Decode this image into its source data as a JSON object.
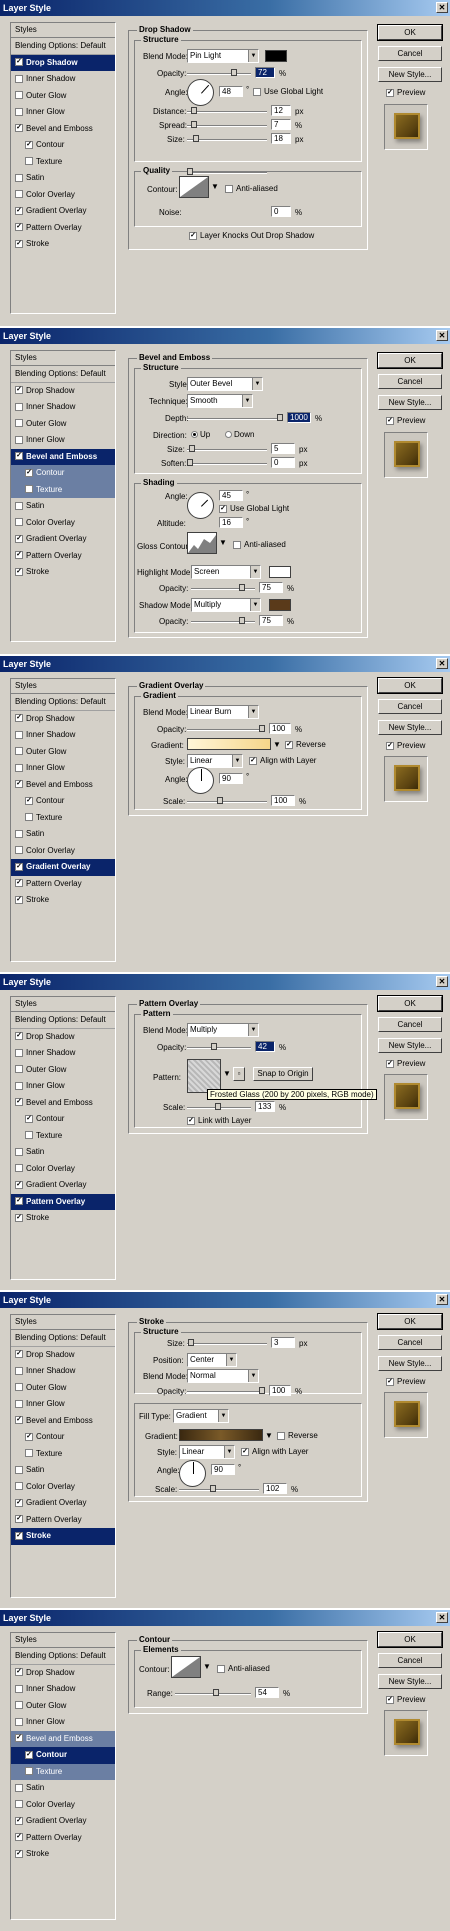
{
  "window_title": "Layer Style",
  "buttons": {
    "ok": "OK",
    "cancel": "Cancel",
    "new_style": "New Style...",
    "preview": "Preview"
  },
  "styles_list": {
    "header": "Styles",
    "blending": "Blending Options: Default",
    "items": [
      "Drop Shadow",
      "Inner Shadow",
      "Outer Glow",
      "Inner Glow",
      "Bevel and Emboss",
      "Contour",
      "Texture",
      "Satin",
      "Color Overlay",
      "Gradient Overlay",
      "Pattern Overlay",
      "Stroke"
    ]
  },
  "drop_shadow": {
    "title": "Drop Shadow",
    "structure": "Structure",
    "blend_mode_label": "Blend Mode:",
    "blend_mode": "Pin Light",
    "color": "#000000",
    "opacity_label": "Opacity:",
    "opacity": "72",
    "unit_pct": "%",
    "angle_label": "Angle:",
    "angle": "48",
    "deg": "°",
    "use_global_light": "Use Global Light",
    "distance_label": "Distance:",
    "distance": "12",
    "unit_px": "px",
    "spread_label": "Spread:",
    "spread": "7",
    "size_label": "Size:",
    "size": "18",
    "quality": "Quality",
    "contour_label": "Contour:",
    "anti_aliased": "Anti-aliased",
    "noise_label": "Noise:",
    "noise": "0",
    "knocks_out": "Layer Knocks Out Drop Shadow"
  },
  "bevel": {
    "title": "Bevel and Emboss",
    "structure": "Structure",
    "style_label": "Style:",
    "style": "Outer Bevel",
    "technique_label": "Technique:",
    "technique": "Smooth",
    "depth_label": "Depth:",
    "depth": "1000",
    "direction_label": "Direction:",
    "up": "Up",
    "down": "Down",
    "size_label": "Size:",
    "size": "5",
    "soften_label": "Soften:",
    "soften": "0",
    "shading": "Shading",
    "angle_label": "Angle:",
    "angle": "45",
    "use_global_light": "Use Global Light",
    "altitude_label": "Altitude:",
    "altitude": "16",
    "gloss_label": "Gloss Contour:",
    "anti_aliased": "Anti-aliased",
    "highlight_label": "Highlight Mode:",
    "highlight": "Screen",
    "highlight_color": "#ffffff",
    "opacity_label": "Opacity:",
    "hl_opacity": "75",
    "shadow_label": "Shadow Mode:",
    "shadow": "Multiply",
    "shadow_color": "#5a3a1a",
    "sh_opacity": "75"
  },
  "gradient": {
    "title": "Gradient Overlay",
    "sub": "Gradient",
    "blend_mode_label": "Blend Mode:",
    "blend_mode": "Linear Burn",
    "opacity_label": "Opacity:",
    "opacity": "100",
    "gradient_label": "Gradient:",
    "reverse": "Reverse",
    "style_label": "Style:",
    "style": "Linear",
    "align": "Align with Layer",
    "angle_label": "Angle:",
    "angle": "90",
    "scale_label": "Scale:",
    "scale": "100"
  },
  "pattern": {
    "title": "Pattern Overlay",
    "sub": "Pattern",
    "blend_mode_label": "Blend Mode:",
    "blend_mode": "Multiply",
    "opacity_label": "Opacity:",
    "opacity": "42",
    "pattern_label": "Pattern:",
    "snap": "Snap to Origin",
    "tooltip": "Frosted Glass (200 by 200 pixels, RGB mode)",
    "scale_label": "Scale:",
    "scale": "133",
    "link": "Link with Layer"
  },
  "stroke": {
    "title": "Stroke",
    "structure": "Structure",
    "size_label": "Size:",
    "size": "3",
    "position_label": "Position:",
    "position": "Center",
    "blend_mode_label": "Blend Mode:",
    "blend_mode": "Normal",
    "opacity_label": "Opacity:",
    "opacity": "100",
    "fill_type_label": "Fill Type:",
    "fill_type": "Gradient",
    "gradient_label": "Gradient:",
    "reverse": "Reverse",
    "style_label": "Style:",
    "style": "Linear",
    "align": "Align with Layer",
    "angle_label": "Angle:",
    "angle": "90",
    "scale_label": "Scale:",
    "scale": "102"
  },
  "contour": {
    "title": "Contour",
    "sub": "Elements",
    "contour_label": "Contour:",
    "anti_aliased": "Anti-aliased",
    "range_label": "Range:",
    "range": "54"
  }
}
